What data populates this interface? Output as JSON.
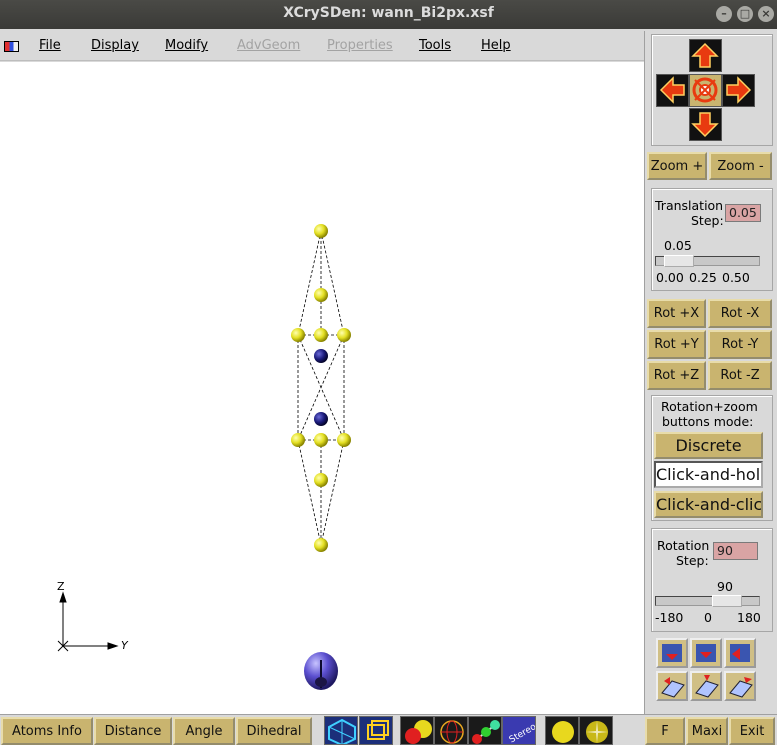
{
  "window": {
    "title": "XCrySDen: wann_Bi2px.xsf"
  },
  "menubar": {
    "items": [
      {
        "label": "File",
        "enabled": true
      },
      {
        "label": "Display",
        "enabled": true
      },
      {
        "label": "Modify",
        "enabled": true
      },
      {
        "label": "AdvGeom",
        "enabled": false
      },
      {
        "label": "Properties",
        "enabled": false
      },
      {
        "label": "Tools",
        "enabled": true
      },
      {
        "label": "Help",
        "enabled": true
      }
    ]
  },
  "viewer": {
    "axes": {
      "z_label": "Z",
      "y_label": "Y"
    }
  },
  "panel": {
    "zoom_in": "Zoom +",
    "zoom_out": "Zoom -",
    "translation": {
      "label_line1": "Translation",
      "label_line2": "Step:",
      "value": "0.05",
      "slider_value": "0.05",
      "ticks": [
        "0.00",
        "0.25",
        "0.50"
      ]
    },
    "rot_buttons": [
      "Rot +X",
      "Rot -X",
      "Rot +Y",
      "Rot -Y",
      "Rot +Z",
      "Rot -Z"
    ],
    "mode": {
      "label_line1": "Rotation+zoom",
      "label_line2": "buttons mode:",
      "options": [
        "Discrete",
        "Click-and-hold",
        "Click-and-click"
      ]
    },
    "rotation": {
      "label_line1": "Rotation",
      "label_line2": "Step:",
      "value": "90",
      "slider_value": "90",
      "ticks": [
        "-180",
        "0",
        "180"
      ]
    }
  },
  "bottombar": {
    "atoms_info": "Atoms Info",
    "distance": "Distance",
    "angle": "Angle",
    "dihedral": "Dihedral",
    "f": "F",
    "maxi": "Maxi",
    "exit": "Exit"
  },
  "colors": {
    "button_gold": "#c9b46f",
    "atom_bi": "#e4e023",
    "atom_other": "#1a1a7a",
    "wannier_lobe": "#5b4fd0",
    "entry_pink": "#d9a4a4"
  }
}
